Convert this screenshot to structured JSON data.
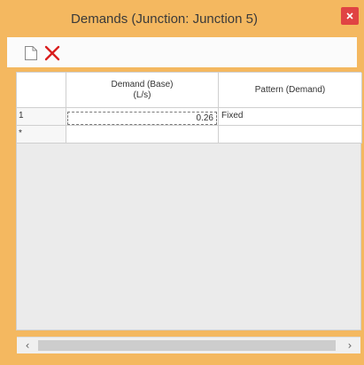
{
  "window": {
    "title": "Demands (Junction: Junction 5)",
    "colors": {
      "frame": "#f4b860",
      "close_button": "#e04343",
      "delete_icon": "#d91e1e"
    }
  },
  "toolbar": {
    "new_icon": "new-document-icon",
    "delete_icon": "delete-x-icon"
  },
  "grid": {
    "columns": [
      {
        "label": "Demand (Base)\n(L/s)"
      },
      {
        "label": "Pattern (Demand)"
      }
    ],
    "rows": [
      {
        "row_header": "1",
        "demand": "0.26",
        "pattern": "Fixed"
      },
      {
        "row_header": "*",
        "demand": "",
        "pattern": ""
      }
    ]
  },
  "scrollbar": {
    "left_arrow": "‹",
    "right_arrow": "›"
  }
}
